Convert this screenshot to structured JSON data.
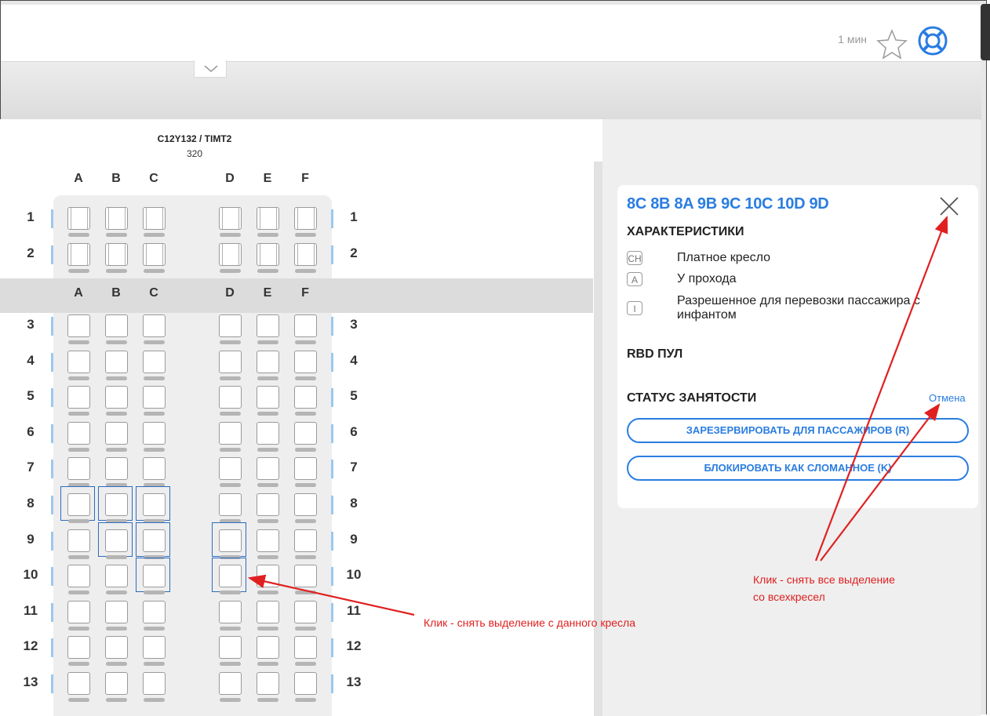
{
  "header": {
    "timer": "1 мин",
    "icons": {
      "star": "star-icon",
      "help": "lifebuoy-icon",
      "collapse": "chevron-down-icon"
    }
  },
  "aircraft": {
    "config": "C12Y132 / TIMT2",
    "type": "320"
  },
  "seat_map": {
    "columns": [
      "A",
      "B",
      "C",
      "D",
      "E",
      "F"
    ],
    "business_rows": [
      "1",
      "2"
    ],
    "economy_rows": [
      "3",
      "4",
      "5",
      "6",
      "7",
      "8",
      "9",
      "10",
      "11",
      "12",
      "13"
    ],
    "selected_seats": [
      "8A",
      "8B",
      "8C",
      "9B",
      "9C",
      "9D",
      "10C",
      "10D"
    ]
  },
  "panel": {
    "title": "8C 8B 8A 9B 9C 10C 10D 9D",
    "characteristics_heading": "ХАРАКТЕРИСТИКИ",
    "features": [
      {
        "code": "CH",
        "label": "Платное кресло"
      },
      {
        "code": "A",
        "label": "У прохода"
      },
      {
        "code": "I",
        "label": "Разрешенное для перевозки пассажира с инфантом"
      }
    ],
    "rbd_heading": "RBD ПУЛ",
    "status_heading": "СТАТУС ЗАНЯТОСТИ",
    "cancel_link": "Отмена",
    "reserve_button": "ЗАРЕЗЕРВИРОВАТЬ ДЛЯ ПАССАЖИРОВ (R)",
    "block_button": "БЛОКИРОВАТЬ КАК СЛОМАННОЕ (K)"
  },
  "annotations": {
    "seat_note": "Клик - снять выделение с данного кресла",
    "all_note_line1": "Клик - снять все выделение",
    "all_note_line2": "со всехкресел"
  },
  "colors": {
    "accent": "#2a7de1",
    "annotation": "#e02020",
    "selection": "#2c6bbf"
  }
}
